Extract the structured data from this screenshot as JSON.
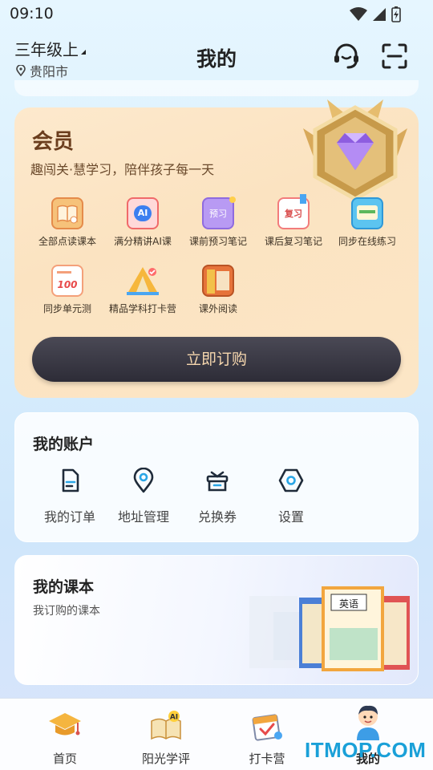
{
  "status_bar": {
    "time": "09:10",
    "icons": [
      "wifi-icon",
      "signal-icon",
      "battery-charging-icon"
    ]
  },
  "header": {
    "grade": "三年级上",
    "city": "贵阳市",
    "title": "我的",
    "icons": [
      "customer-service-icon",
      "scan-icon"
    ]
  },
  "member": {
    "title": "会员",
    "subtitle": "趣闯关·慧学习，陪伴孩子每一天",
    "benefits": [
      {
        "label": "全部点读课本",
        "icon": "book-read-icon"
      },
      {
        "label": "满分精讲AI课",
        "icon": "ai-lesson-icon",
        "icon_text": "AI"
      },
      {
        "label": "课前预习笔记",
        "icon": "preview-notes-icon",
        "icon_text": "预习"
      },
      {
        "label": "课后复习笔记",
        "icon": "review-notes-icon",
        "icon_text": "复习"
      },
      {
        "label": "同步在线练习",
        "icon": "online-practice-icon"
      },
      {
        "label": "同步单元测",
        "icon": "unit-test-icon",
        "icon_text": "100"
      },
      {
        "label": "精品学科打卡营",
        "icon": "checkin-camp-icon"
      },
      {
        "label": "课外阅读",
        "icon": "extra-reading-icon"
      }
    ],
    "buy_label": "立即订购",
    "colors": {
      "card": "#fce6c6",
      "title": "#6b3e1e",
      "button": "#2d2c37",
      "button_text": "#f6d7ae"
    }
  },
  "account": {
    "title": "我的账户",
    "items": [
      {
        "label": "我的订单",
        "icon": "order-icon"
      },
      {
        "label": "地址管理",
        "icon": "location-pin-icon"
      },
      {
        "label": "兑换券",
        "icon": "gift-coupon-icon"
      },
      {
        "label": "设置",
        "icon": "settings-hex-icon"
      }
    ]
  },
  "books": {
    "title": "我的课本",
    "subtitle": "我订购的课本",
    "book_cover_text": "英语"
  },
  "bottom_nav": {
    "items": [
      {
        "label": "首页",
        "icon": "graduation-cap-icon"
      },
      {
        "label": "阳光学评",
        "icon": "ai-book-icon"
      },
      {
        "label": "打卡营",
        "icon": "checkin-calendar-icon"
      },
      {
        "label": "我的",
        "icon": "avatar-boy-icon",
        "active": true
      }
    ]
  },
  "watermark": "ITMOP.COM",
  "accent_color": "#1aa0d8"
}
